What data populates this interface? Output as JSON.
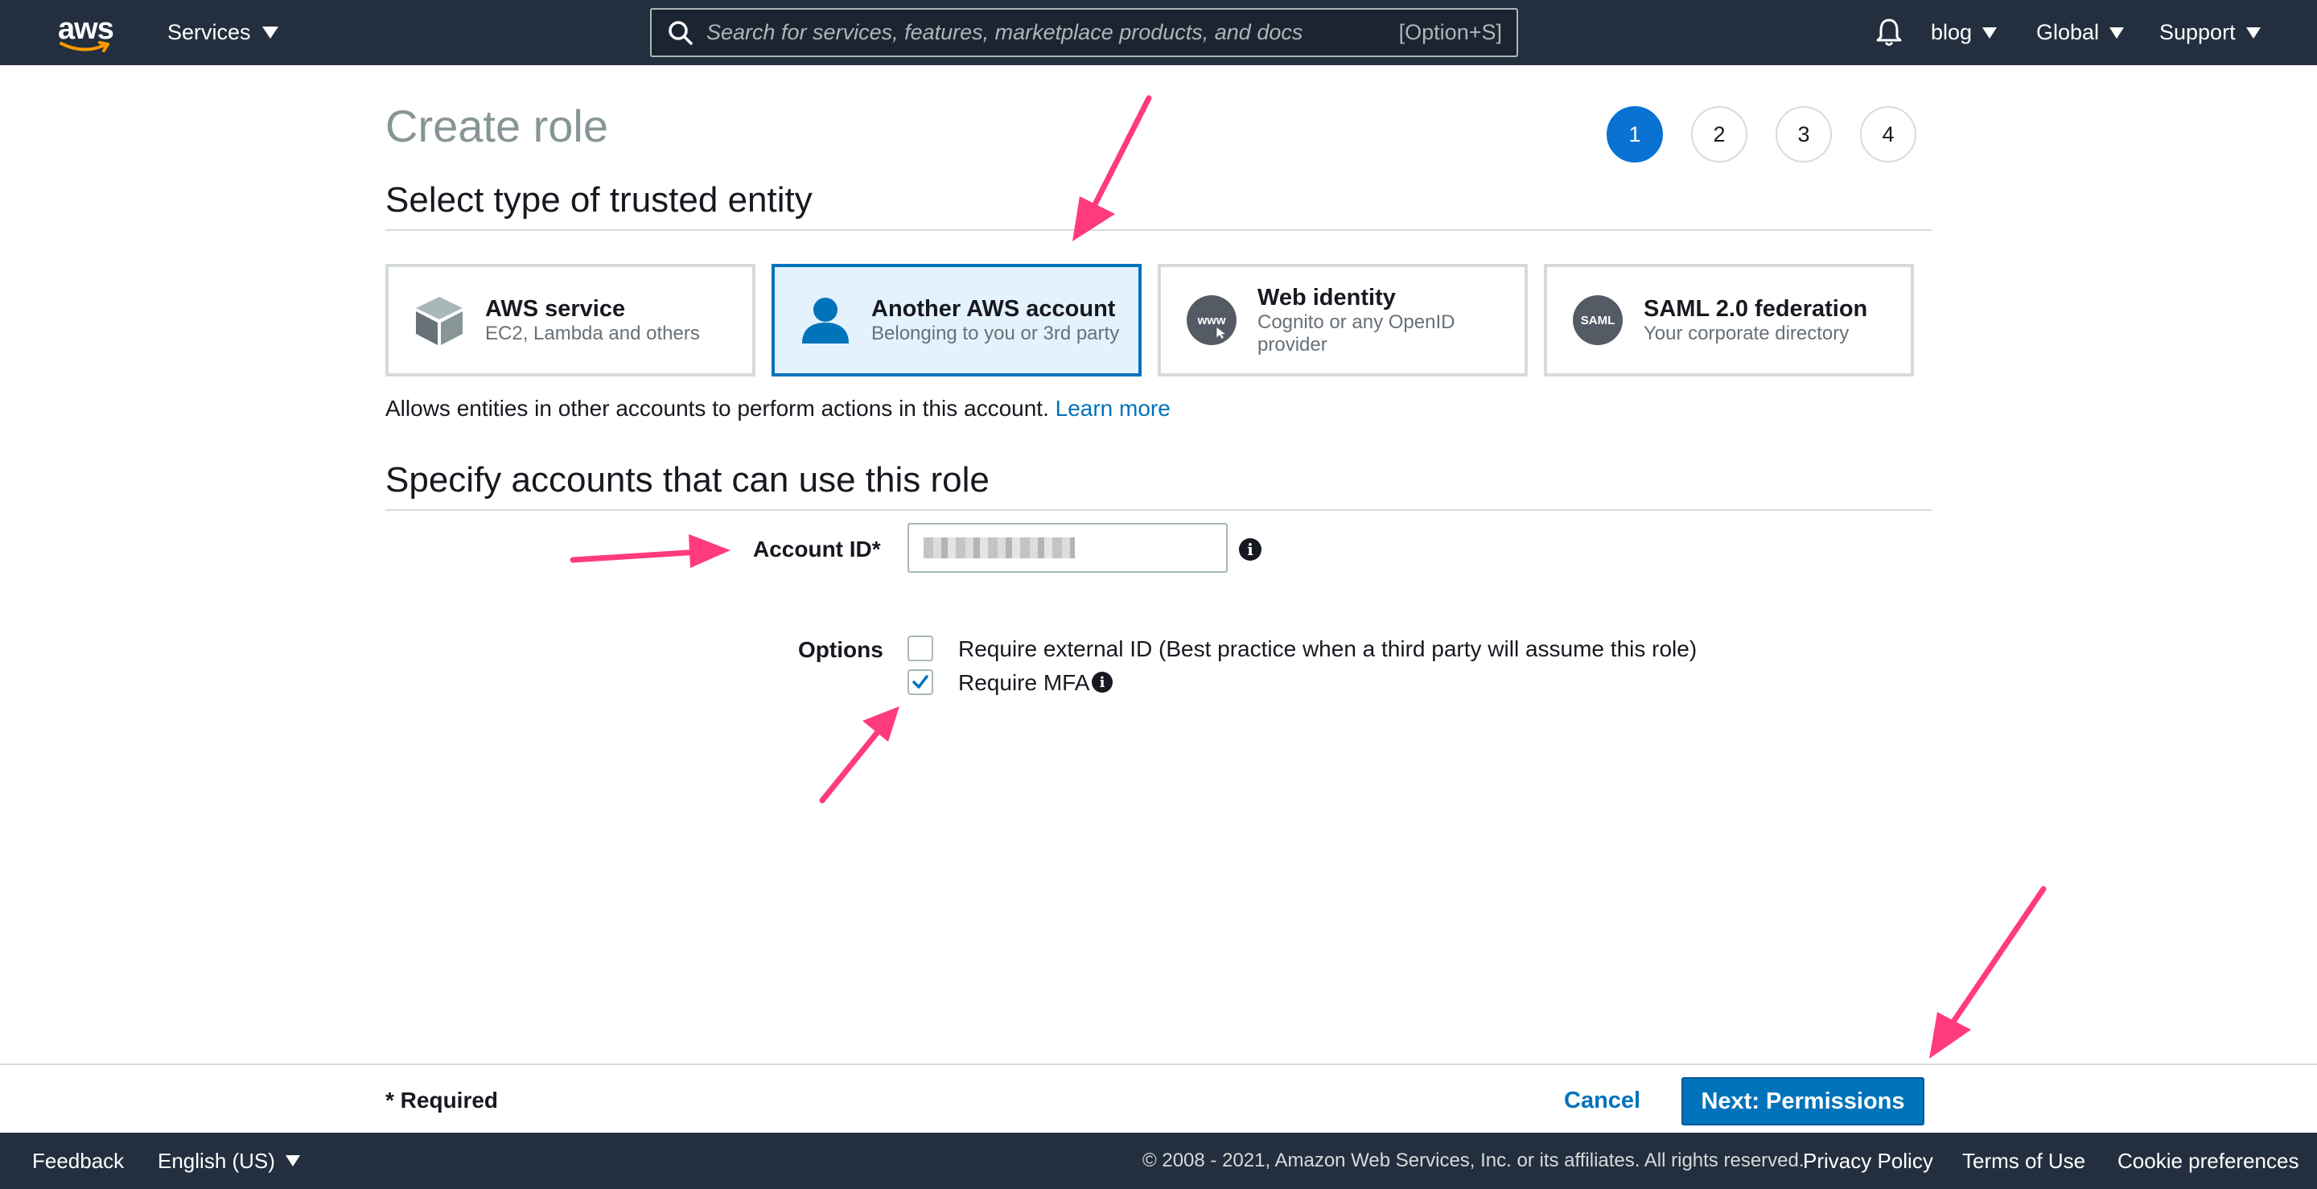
{
  "topnav": {
    "logo_text": "aws",
    "services_label": "Services",
    "search_placeholder": "Search for services, features, marketplace products, and docs",
    "search_shortcut": "[Option+S]",
    "account_label": "blog",
    "region_label": "Global",
    "support_label": "Support"
  },
  "page": {
    "title": "Create role",
    "steps": [
      "1",
      "2",
      "3",
      "4"
    ],
    "active_step": 1
  },
  "trusted_entity": {
    "heading": "Select type of trusted entity",
    "cards": [
      {
        "title": "AWS service",
        "subtitle": "EC2, Lambda and others",
        "icon": "cube-icon",
        "selected": false
      },
      {
        "title": "Another AWS account",
        "subtitle": "Belonging to you or 3rd party",
        "icon": "user-icon",
        "selected": true
      },
      {
        "title": "Web identity",
        "subtitle": "Cognito or any OpenID provider",
        "icon": "www-icon",
        "icon_text": "www",
        "selected": false
      },
      {
        "title": "SAML 2.0 federation",
        "subtitle": "Your corporate directory",
        "icon": "saml-icon",
        "icon_text": "SAML",
        "selected": false
      }
    ],
    "description": "Allows entities in other accounts to perform actions in this account.",
    "learn_more": "Learn more"
  },
  "accounts": {
    "heading": "Specify accounts that can use this role",
    "account_id_label": "Account ID*",
    "options_label": "Options",
    "options": [
      {
        "label": "Require external ID (Best practice when a third party will assume this role)",
        "checked": false
      },
      {
        "label": "Require MFA",
        "checked": true
      }
    ]
  },
  "action_bar": {
    "required_note": "* Required",
    "cancel_label": "Cancel",
    "next_label": "Next: Permissions"
  },
  "footer": {
    "feedback": "Feedback",
    "language": "English (US)",
    "copyright": "© 2008 - 2021, Amazon Web Services, Inc. or its affiliates. All rights reserved.",
    "privacy": "Privacy Policy",
    "terms": "Terms of Use",
    "cookies": "Cookie preferences"
  },
  "colors": {
    "nav_bg": "#232f3e",
    "accent_blue": "#0073bb",
    "step_active": "#0972d3",
    "selected_card_bg": "#e3f2fc",
    "annotation_arrow": "#ff3b7b",
    "logo_smile": "#ff9900"
  }
}
